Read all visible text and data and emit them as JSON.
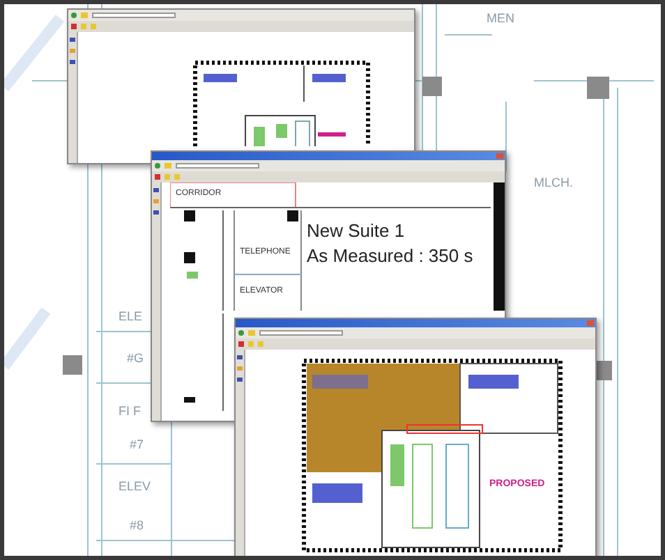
{
  "background": {
    "labels": [
      "MEN",
      "MLCH.",
      "ELE",
      "#G",
      "FI F",
      "#7",
      "ELEV",
      "#8"
    ]
  },
  "windows": [
    {
      "kind": "cropped"
    },
    {
      "kind": "framed",
      "labels": [
        {
          "text": "CORRIDOR",
          "kind": "small"
        },
        {
          "text": "TELEPHONE",
          "kind": "small"
        },
        {
          "text": "ELEVATOR",
          "kind": "small"
        },
        {
          "text": "New Suite 1",
          "kind": "large"
        },
        {
          "text": "As Measured : 350 s",
          "kind": "large"
        }
      ]
    },
    {
      "kind": "framed",
      "labels": [
        {
          "text": "PROPOSED",
          "kind": "accent"
        }
      ]
    }
  ]
}
